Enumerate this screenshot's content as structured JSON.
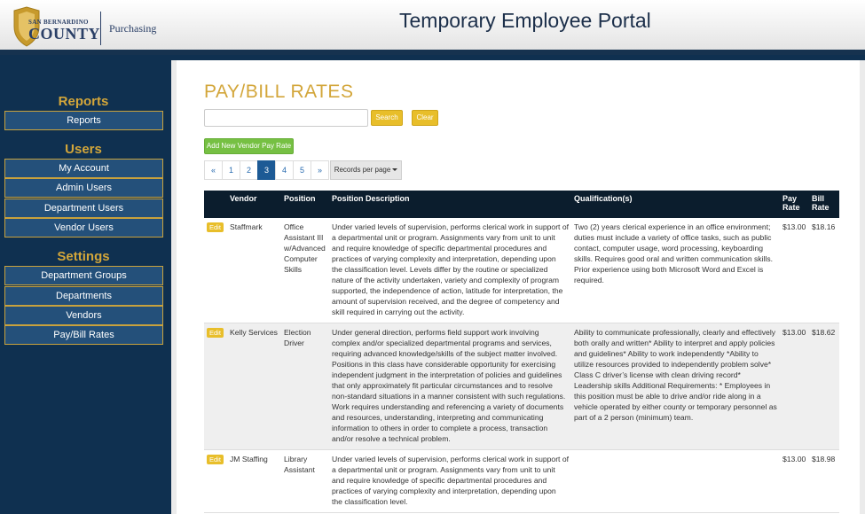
{
  "header": {
    "logo_top": "SAN BERNARDINO",
    "logo_main": "COUNTY",
    "logo_dept": "Purchasing",
    "portal_title": "Temporary Employee Portal"
  },
  "sidebar": {
    "sections": [
      {
        "heading": "Reports",
        "items": [
          "Reports"
        ]
      },
      {
        "heading": "Users",
        "items": [
          "My Account",
          "Admin Users",
          "Department Users",
          "Vendor Users"
        ]
      },
      {
        "heading": "Settings",
        "items": [
          "Department Groups",
          "Departments",
          "Vendors",
          "Pay/Bill Rates"
        ]
      }
    ]
  },
  "main": {
    "title": "PAY/BILL RATES",
    "search": {
      "value": "",
      "placeholder": ""
    },
    "search_label": "Search",
    "clear_label": "Clear",
    "add_label": "Add New Vendor Pay Rate",
    "pager": {
      "prev": "«",
      "pages": [
        "1",
        "2",
        "3",
        "4",
        "5"
      ],
      "active_page": "3",
      "next": "»",
      "records_per_page": "Records per page"
    },
    "table": {
      "headers": {
        "vendor": "Vendor",
        "position": "Position",
        "description": "Position Description",
        "qualifications": "Qualification(s)",
        "pay": "Pay Rate",
        "bill": "Bill Rate"
      },
      "edit_label": "Edit",
      "rows": [
        {
          "vendor": "Staffmark",
          "position": "Office Assistant III w/Advanced Computer Skills",
          "description": "Under varied levels of supervision, performs clerical work in support of a departmental unit or program. Assignments vary from unit to unit and require knowledge of specific departmental procedures and practices of varying complexity and interpretation, depending upon the classification level. Levels differ by the routine or specialized nature of the activity undertaken, variety and complexity of program supported, the independence of action, latitude for interpretation, the amount of supervision received, and the degree of competency and skill required in carrying out the activity.",
          "qualifications": "Two (2) years clerical experience in an office environment; duties must include a variety of office tasks, such as public contact, computer usage, word processing, keyboarding skills. Requires good oral and written communication skills. Prior experience using both Microsoft Word and Excel is required.",
          "pay": "$13.00",
          "bill": "$18.16"
        },
        {
          "vendor": "Kelly Services",
          "position": "Election Driver",
          "description": "Under general direction, performs field support work involving complex and/or specialized departmental programs and services, requiring advanced knowledge/skills of the subject matter involved. Positions in this class have considerable opportunity for exercising independent judgment in the interpretation of policies and guidelines that only approximately fit particular circumstances and to resolve non-standard situations in a manner consistent with such regulations. Work requires understanding and referencing a variety of documents and resources, understanding, interpreting and communicating information to others in order to complete a process, transaction and/or resolve a technical problem.",
          "qualifications": "Ability to communicate professionally, clearly and effectively both orally and written* Ability to interpret and apply policies and guidelines* Ability to work independently *Ability to utilize resources provided to independently problem solve* Class C driver’s license with clean driving record* Leadership skills Additional Requirements: * Employees in this position must be able to drive and/or ride along in a vehicle operated by either county or temporary personnel as part of a 2 person (minimum) team.",
          "pay": "$13.00",
          "bill": "$18.62"
        },
        {
          "vendor": "JM Staffing",
          "position": "Library Assistant",
          "description": "Under varied levels of supervision, performs clerical work in support of a departmental unit or program. Assignments vary from unit to unit and require knowledge of specific departmental procedures and practices of varying complexity and interpretation, depending upon the classification level.",
          "qualifications": "",
          "pay": "$13.00",
          "bill": "$18.98"
        }
      ]
    }
  }
}
